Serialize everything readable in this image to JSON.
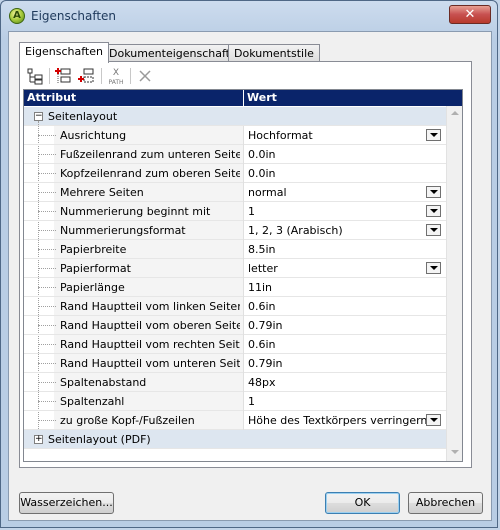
{
  "window": {
    "title": "Eigenschaften",
    "close_symbol": "✕",
    "icon_letter": "A"
  },
  "tabs": [
    {
      "label": "Eigenschaften",
      "active": true
    },
    {
      "label": "Dokumenteigenschaften",
      "active": false
    },
    {
      "label": "Dokumentstile",
      "active": false
    }
  ],
  "toolbar": {
    "buttons": [
      "tree-view-icon",
      "add-group-icon",
      "add-property-icon",
      "xpath-icon",
      "delete-icon"
    ],
    "path_label": "PATH"
  },
  "grid": {
    "col_attr": "Attribut",
    "col_value": "Wert",
    "groups": [
      {
        "label": "Seitenlayout",
        "expanded": true,
        "items": [
          {
            "attr": "Ausrichtung",
            "value": "Hochformat",
            "dropdown": true
          },
          {
            "attr": "Fußzeilenrand zum unteren Seitenr...",
            "value": "0.0in",
            "dropdown": false
          },
          {
            "attr": "Kopfzeilenrand zum oberen Seitenr...",
            "value": "0.0in",
            "dropdown": false
          },
          {
            "attr": "Mehrere Seiten",
            "value": "normal",
            "dropdown": true
          },
          {
            "attr": "Nummerierung beginnt mit",
            "value": "1",
            "dropdown": true
          },
          {
            "attr": "Nummerierungsformat",
            "value": "1, 2, 3 (Arabisch)",
            "dropdown": true
          },
          {
            "attr": "Papierbreite",
            "value": "8.5in",
            "dropdown": false
          },
          {
            "attr": "Papierformat",
            "value": "letter",
            "dropdown": true
          },
          {
            "attr": "Papierlänge",
            "value": "11in",
            "dropdown": false
          },
          {
            "attr": "Rand Hauptteil vom linken Seitenrand",
            "value": "0.6in",
            "dropdown": false
          },
          {
            "attr": "Rand Hauptteil vom oberen Seitenr...",
            "value": "0.79in",
            "dropdown": false
          },
          {
            "attr": "Rand Hauptteil vom rechten Seitenr...",
            "value": "0.6in",
            "dropdown": false
          },
          {
            "attr": "Rand Hauptteil vom unteren Seitenr...",
            "value": "0.79in",
            "dropdown": false
          },
          {
            "attr": "Spaltenabstand",
            "value": "48px",
            "dropdown": false
          },
          {
            "attr": "Spaltenzahl",
            "value": "1",
            "dropdown": false
          },
          {
            "attr": "zu große Kopf-/Fußzeilen",
            "value": "Höhe des Textkörpers verringern (...",
            "dropdown": true
          }
        ]
      },
      {
        "label": "Seitenlayout (PDF)",
        "expanded": false,
        "items": []
      }
    ]
  },
  "buttons": {
    "watermark": "Wasserzeichen...",
    "ok": "OK",
    "cancel": "Abbrechen"
  },
  "colors": {
    "header_bg": "#0a246a",
    "group_row_bg": "#dde6f0",
    "close_button": "#c75050"
  }
}
